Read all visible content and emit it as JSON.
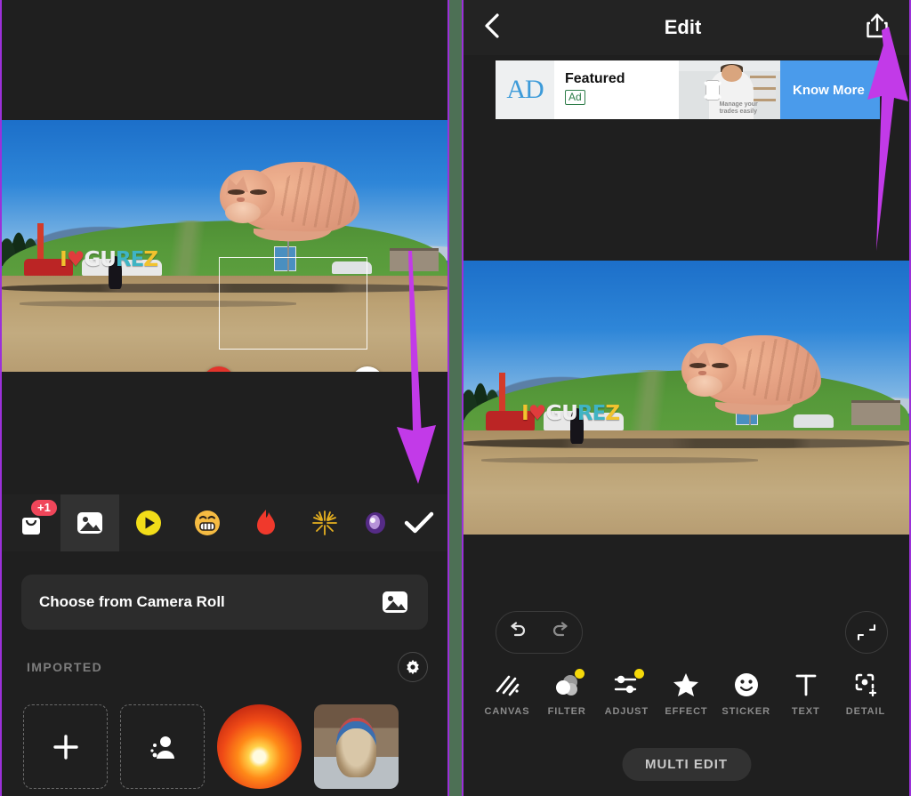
{
  "theme": {
    "accent_arrow": "#c23ae8",
    "panel_border": "#9b30d9",
    "background_gap": "#4d7055",
    "app_background": "#1f1f1f",
    "badge_yellow": "#f5d90a",
    "delete_red": "#e2342b",
    "cta_blue": "#4a9beb"
  },
  "left_panel": {
    "name": "sticker-picker-screen",
    "photo": {
      "sign_text": [
        "I",
        "♥",
        "G",
        "U",
        "R",
        "E",
        "Z"
      ],
      "sign_plain": "I ♥ GUREZ"
    },
    "sticker_overlay": {
      "handles": [
        {
          "name": "delete-handle",
          "icon": "close-icon"
        },
        {
          "name": "edit-handle",
          "icon": "pencil-icon"
        },
        {
          "name": "flip-handle",
          "icon": "flip-horizontal-icon"
        },
        {
          "name": "resize-handle",
          "icon": "resize-diagonal-icon"
        }
      ]
    },
    "category_bar": {
      "items": [
        {
          "name": "shop-bag",
          "icon": "shopping-bag-icon",
          "badge": "+1",
          "active": false
        },
        {
          "name": "my-stickers",
          "icon": "image-icon",
          "badge": "",
          "active": true
        },
        {
          "name": "animated",
          "icon": "play-circle-icon",
          "badge": "",
          "active": false
        },
        {
          "name": "emoji",
          "icon": "grin-emoji-icon",
          "badge": "",
          "active": false
        },
        {
          "name": "flame",
          "icon": "flame-icon",
          "badge": "",
          "active": false
        },
        {
          "name": "sparkle",
          "icon": "firework-icon",
          "badge": "",
          "active": false
        },
        {
          "name": "galaxy",
          "icon": "galaxy-icon",
          "badge": "",
          "active": false
        }
      ],
      "confirm": {
        "name": "confirm-button",
        "icon": "check-icon"
      }
    },
    "camera_roll": {
      "label": "Choose from Camera Roll",
      "icon": "photo-library-icon"
    },
    "imported": {
      "title": "IMPORTED",
      "settings_icon": "gear-icon",
      "thumbs": [
        {
          "name": "add-sticker",
          "icon": "plus-icon",
          "kind": "dashed"
        },
        {
          "name": "cutout-person",
          "icon": "person-cutout-icon",
          "kind": "dashed"
        },
        {
          "name": "ball-sticker",
          "icon": "",
          "kind": "ball"
        },
        {
          "name": "basket-sticker",
          "icon": "",
          "kind": "basket"
        }
      ]
    },
    "annotation": {
      "arrow": "down-arrow-to-confirm-button"
    }
  },
  "right_panel": {
    "name": "edit-screen",
    "topbar": {
      "back_icon": "chevron-left-icon",
      "title": "Edit",
      "share_icon": "share-icon"
    },
    "ad": {
      "logo_text": "AD",
      "headline": "Featured",
      "badge": "Ad",
      "media_caption": "Manage your\ntrades easily",
      "cta_label": "Know More",
      "close_icon": "close-x-icon"
    },
    "photo": {
      "sign_plain": "I ♥ GUREZ"
    },
    "history": {
      "undo_icon": "undo-arrow-icon",
      "redo_icon": "redo-arrow-icon",
      "fit_icon": "collapse-fit-icon"
    },
    "tools": [
      {
        "label": "CANVAS",
        "icon": "canvas-stripes-icon",
        "dot": false
      },
      {
        "label": "FILTER",
        "icon": "filter-circles-icon",
        "dot": true
      },
      {
        "label": "ADJUST",
        "icon": "sliders-icon",
        "dot": true
      },
      {
        "label": "EFFECT",
        "icon": "star-icon",
        "dot": false
      },
      {
        "label": "STICKER",
        "icon": "smiley-icon",
        "dot": false
      },
      {
        "label": "TEXT",
        "icon": "text-t-icon",
        "dot": false
      },
      {
        "label": "DETAIL",
        "icon": "detail-focus-icon",
        "dot": false
      }
    ],
    "multi_edit": {
      "label": "MULTI EDIT"
    },
    "annotation": {
      "arrow": "up-arrow-to-share-button"
    }
  }
}
